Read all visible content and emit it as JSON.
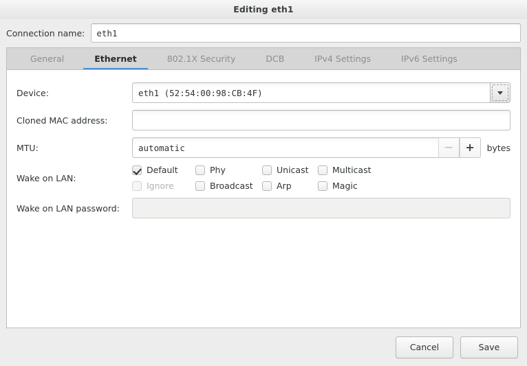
{
  "window": {
    "title": "Editing eth1"
  },
  "connection_name": {
    "label": "Connection name:",
    "value": "eth1",
    "placeholder": ""
  },
  "tabs": [
    {
      "label": "General",
      "active": false
    },
    {
      "label": "Ethernet",
      "active": true
    },
    {
      "label": "802.1X Security",
      "active": false
    },
    {
      "label": "DCB",
      "active": false
    },
    {
      "label": "IPv4 Settings",
      "active": false
    },
    {
      "label": "IPv6 Settings",
      "active": false
    }
  ],
  "form": {
    "device": {
      "label": "Device:",
      "value": "eth1 (52:54:00:98:CB:4F)",
      "dropdown_icon": "chevron-down-icon"
    },
    "cloned_mac": {
      "label": "Cloned MAC address:",
      "value": "",
      "placeholder": ""
    },
    "mtu": {
      "label": "MTU:",
      "value": "automatic",
      "units": "bytes",
      "decrement_label": "−",
      "increment_label": "+"
    },
    "wake_on_lan": {
      "label": "Wake on LAN:",
      "options": [
        {
          "label": "Default",
          "checked": true,
          "disabled": false
        },
        {
          "label": "Phy",
          "checked": false,
          "disabled": false
        },
        {
          "label": "Unicast",
          "checked": false,
          "disabled": false
        },
        {
          "label": "Multicast",
          "checked": false,
          "disabled": false
        },
        {
          "label": "Ignore",
          "checked": false,
          "disabled": true
        },
        {
          "label": "Broadcast",
          "checked": false,
          "disabled": false
        },
        {
          "label": "Arp",
          "checked": false,
          "disabled": false
        },
        {
          "label": "Magic",
          "checked": false,
          "disabled": false
        }
      ]
    },
    "wol_password": {
      "label": "Wake on LAN password:",
      "value": "",
      "placeholder": "",
      "disabled": true
    }
  },
  "footer": {
    "cancel_label": "Cancel",
    "save_label": "Save"
  },
  "colors": {
    "accent": "#4a90d9",
    "window_bg": "#ededed",
    "panel_bg": "#ffffff",
    "tabbar_bg": "#d6d6d6",
    "text": "#2e3436",
    "muted_text": "#8b8e8f"
  }
}
